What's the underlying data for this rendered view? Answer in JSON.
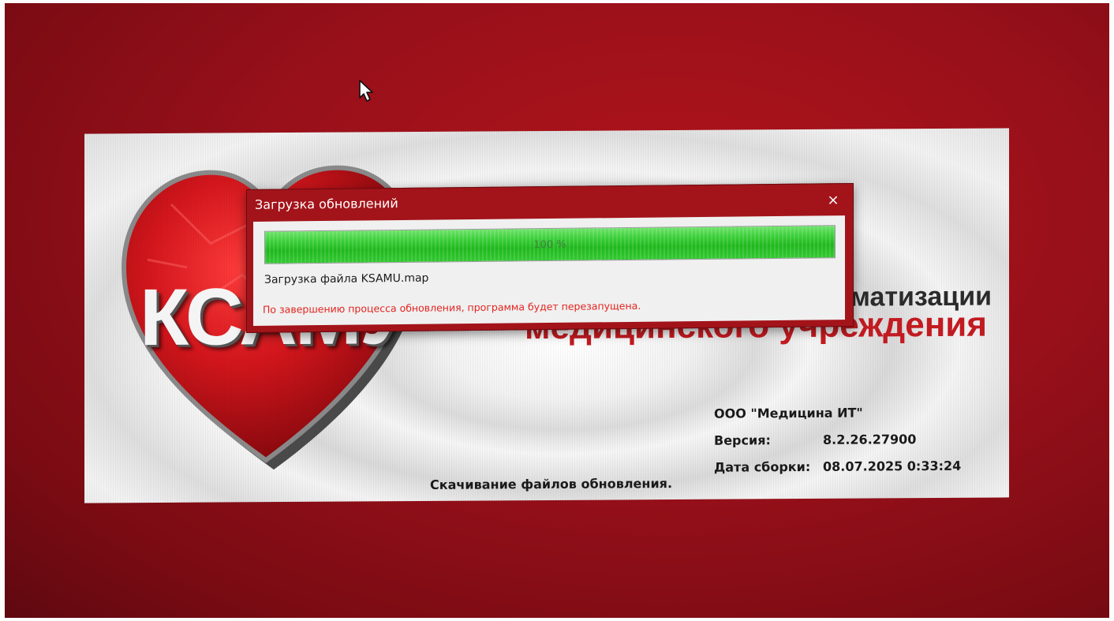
{
  "splash": {
    "logo_text": "КСАМУ",
    "title_line1": "матизации",
    "title_line2": "медицинского учреждения",
    "company": "ООО \"Медицина ИТ\"",
    "version_label": "Версия:",
    "version_value": "8.2.26.27900",
    "build_date_label": "Дата сборки:",
    "build_date_value": "08.07.2025 0:33:24",
    "status": "Скачивание файлов обновления."
  },
  "dialog": {
    "title": "Загрузка обновлений",
    "close_glyph": "×",
    "progress_percent": 100,
    "progress_text": "100 %",
    "file_text": "Загрузка файла KSAMU.map",
    "restart_notice": "По завершению процесса обновления, программа будет перезапущена."
  },
  "colors": {
    "background_red": "#98101a",
    "dialog_red": "#a3141a",
    "progress_green": "#3ccf3a",
    "notice_red": "#e2241f",
    "brand_red": "#c41b21"
  },
  "icons": [
    "cursor-arrow-icon",
    "close-icon",
    "heart-logo-icon"
  ]
}
